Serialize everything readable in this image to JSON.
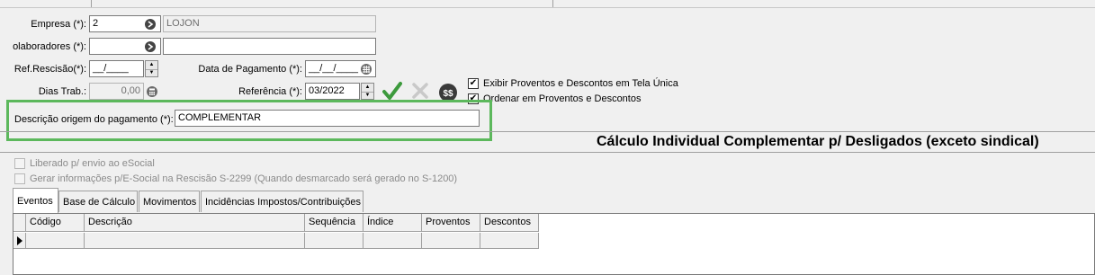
{
  "form": {
    "empresa": {
      "label": "Empresa (*):",
      "code": "2",
      "name": "LOJON"
    },
    "colaboradores": {
      "label": "olaboradores (*):",
      "code": "",
      "name": ""
    },
    "ref_rescisao": {
      "label": "Ref.Rescisão(*):",
      "value": "__/____"
    },
    "data_pagamento": {
      "label": "Data de Pagamento (*):",
      "value": "__/__/____"
    },
    "dias_trab": {
      "label": "Dias Trab.:",
      "value": "0,00"
    },
    "referencia": {
      "label": "Referência (*):",
      "value": "03/2022"
    },
    "descricao": {
      "label": "Descrição origem do pagamento (*):",
      "value": "COMPLEMENTAR"
    }
  },
  "options": {
    "exibir_tela_unica": {
      "label": "Exibir Proventos e Descontos em Tela Única",
      "checked": true
    },
    "ordenar": {
      "label": "Ordenar em Proventos e Descontos",
      "checked": true
    }
  },
  "heading": "Cálculo Individual Complementar p/ Desligados (exceto sindical)",
  "esocial": {
    "liberado": {
      "label": "Liberado p/ envio ao eSocial",
      "checked": false
    },
    "gerar": {
      "label": "Gerar informações p/E-Social na Rescisão S-2299 (Quando desmarcado será gerado no S-1200)",
      "checked": false
    }
  },
  "tabs": [
    {
      "label": "Eventos",
      "active": true
    },
    {
      "label": "Base de Cálculo",
      "active": false
    },
    {
      "label": "Movimentos",
      "active": false
    },
    {
      "label": "Incidências Impostos/Contribuições",
      "active": false
    }
  ],
  "grid": {
    "columns": [
      "Código",
      "Descrição",
      "Sequência",
      "Índice",
      "Proventos",
      "Descontos"
    ],
    "rows": [
      [
        "",
        "",
        "",
        "",
        "",
        ""
      ]
    ]
  },
  "colors": {
    "highlight_frame": "#5cb85c",
    "confirm_green": "#3c9a3c"
  }
}
